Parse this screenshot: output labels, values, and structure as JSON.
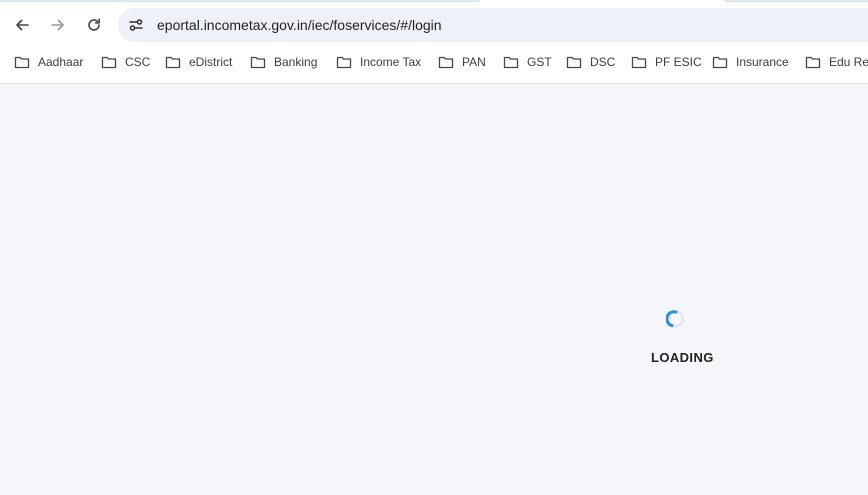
{
  "browser": {
    "url": "eportal.incometax.gov.in/iec/foservices/#/login",
    "icons": {
      "back": "arrow-left-icon",
      "forward": "arrow-right-icon",
      "reload": "reload-icon",
      "site_info": "site-settings-icon",
      "bookmark_folder": "folder-icon"
    }
  },
  "bookmarks": [
    {
      "label": "Aadhaar"
    },
    {
      "label": "CSC"
    },
    {
      "label": "eDistrict"
    },
    {
      "label": "Banking"
    },
    {
      "label": "Income Tax"
    },
    {
      "label": "PAN"
    },
    {
      "label": "GST"
    },
    {
      "label": "DSC"
    },
    {
      "label": "PF ESIC"
    },
    {
      "label": "Insurance"
    },
    {
      "label": "Edu Rec"
    }
  ],
  "page": {
    "loading_text": "LOADING"
  },
  "colors": {
    "page_background": "#f5f6fa",
    "spinner_accent": "#2a8fd6",
    "omnibox": "#eef1f7"
  }
}
